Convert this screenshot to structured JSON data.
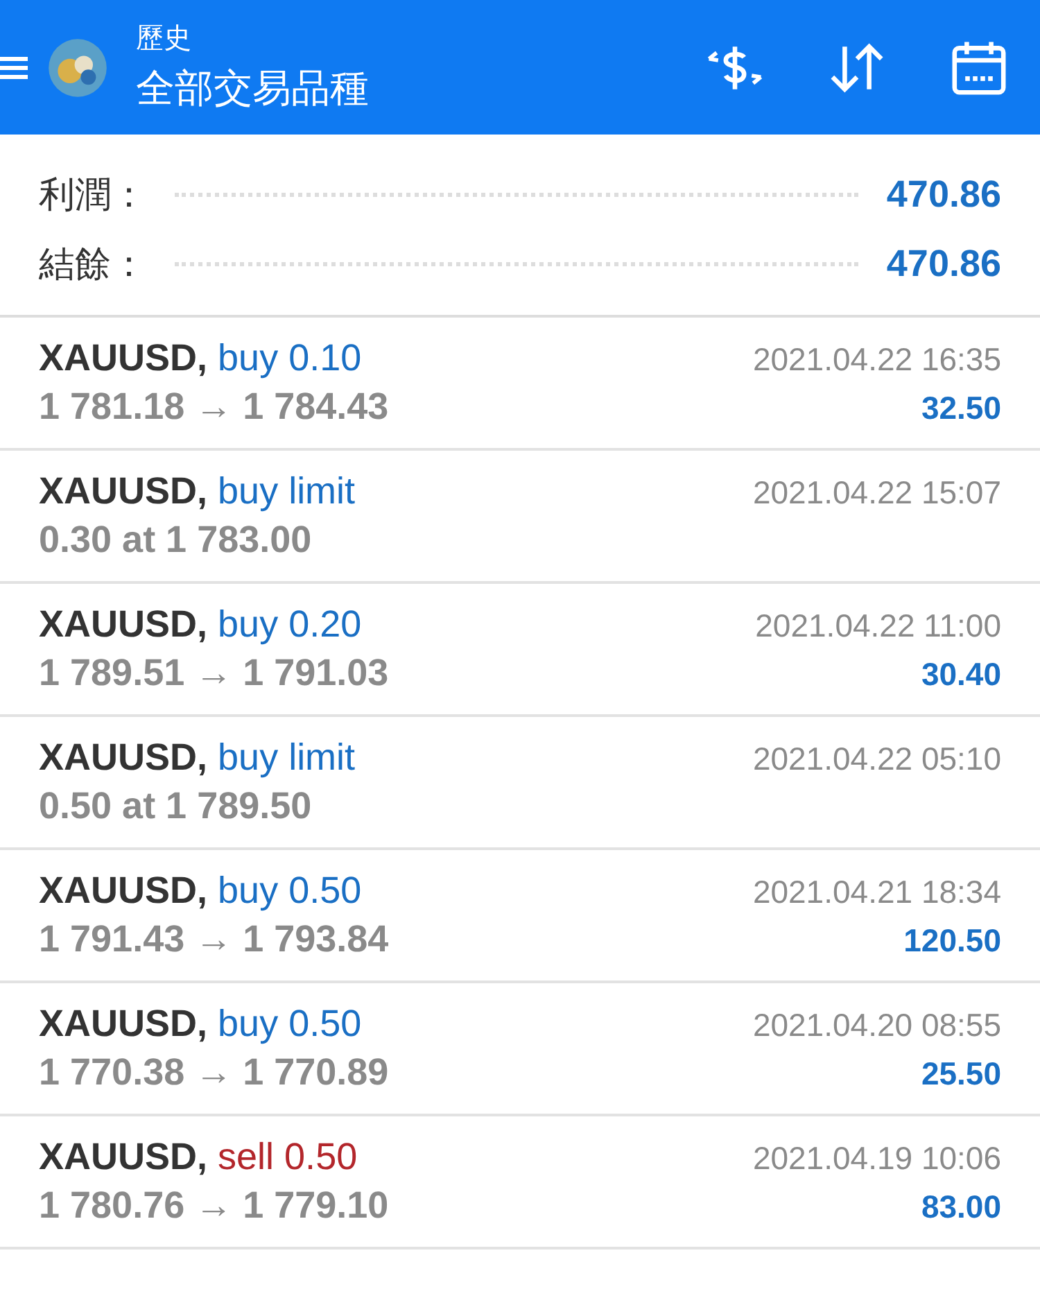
{
  "header": {
    "subtitle": "歷史",
    "title": "全部交易品種"
  },
  "summary": [
    {
      "label": "利潤：",
      "value": "470.86"
    },
    {
      "label": "結餘：",
      "value": "470.86"
    }
  ],
  "trades": [
    {
      "symbol": "XAUUSD,",
      "side": "buy 0.10",
      "kind": "buy",
      "detail": "1 781.18 → 1 784.43",
      "time": "2021.04.22 16:35",
      "profit": "32.50"
    },
    {
      "symbol": "XAUUSD,",
      "side": "buy limit",
      "kind": "buy",
      "detail": "0.30 at 1 783.00",
      "time": "2021.04.22 15:07"
    },
    {
      "symbol": "XAUUSD,",
      "side": "buy 0.20",
      "kind": "buy",
      "detail": "1 789.51 → 1 791.03",
      "time": "2021.04.22 11:00",
      "profit": "30.40"
    },
    {
      "symbol": "XAUUSD,",
      "side": "buy limit",
      "kind": "buy",
      "detail": "0.50 at 1 789.50",
      "time": "2021.04.22 05:10"
    },
    {
      "symbol": "XAUUSD,",
      "side": "buy 0.50",
      "kind": "buy",
      "detail": "1 791.43 → 1 793.84",
      "time": "2021.04.21 18:34",
      "profit": "120.50"
    },
    {
      "symbol": "XAUUSD,",
      "side": "buy 0.50",
      "kind": "buy",
      "detail": "1 770.38 → 1 770.89",
      "time": "2021.04.20 08:55",
      "profit": "25.50"
    },
    {
      "symbol": "XAUUSD,",
      "side": "sell 0.50",
      "kind": "sell",
      "detail": "1 780.76 → 1 779.10",
      "time": "2021.04.19 10:06",
      "profit": "83.00"
    }
  ]
}
